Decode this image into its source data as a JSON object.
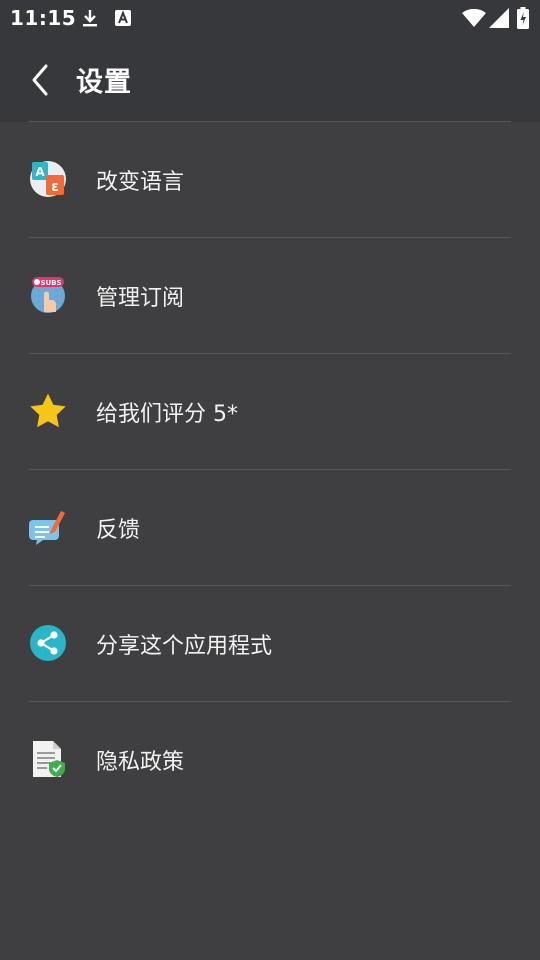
{
  "status_bar": {
    "time": "11:15",
    "icons": [
      "download-icon",
      "a-notification-icon",
      "wifi-icon",
      "signal-icon",
      "battery-icon"
    ]
  },
  "app_bar": {
    "back_icon": "chevron-left-icon",
    "title": "设置"
  },
  "settings": {
    "items": [
      {
        "label": "改变语言",
        "icon": "language-icon"
      },
      {
        "label": "管理订阅",
        "icon": "subscriptions-icon"
      },
      {
        "label": "给我们评分 5*",
        "icon": "star-icon"
      },
      {
        "label": "反馈",
        "icon": "feedback-icon"
      },
      {
        "label": "分享这个应用程式",
        "icon": "share-icon"
      },
      {
        "label": "隐私政策",
        "icon": "privacy-policy-icon"
      }
    ]
  },
  "colors": {
    "background": "#3f3f41",
    "app_bar": "#37383c",
    "divider": "#57575a",
    "star": "#f5c518",
    "share": "#29b6c9"
  }
}
